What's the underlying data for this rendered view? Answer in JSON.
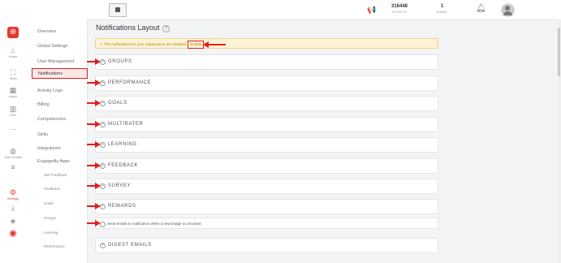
{
  "rail": {
    "items": [
      {
        "icon": "⌂",
        "label": "Home"
      },
      {
        "icon": "⛶",
        "label": "Team"
      },
      {
        "icon": "▦",
        "label": "Agent"
      },
      {
        "icon": "▥",
        "label": "ChO"
      },
      {
        "icon": "···",
        "label": ""
      },
      {
        "icon": "◍",
        "label": "Team Profile"
      },
      {
        "icon": "≡",
        "label": ""
      },
      {
        "icon": "⚙",
        "label": "Settings"
      },
      {
        "icon": "⤓",
        "label": ""
      },
      {
        "icon": "◈",
        "label": ""
      }
    ]
  },
  "nav": {
    "items": [
      "Overview",
      "Global Settings",
      "User Management",
      "Notifications",
      "Activity Logs",
      "Billing",
      "Competencies",
      "Skills",
      "Integrations",
      "Engagedly Apps"
    ],
    "sub_items": [
      "360 Feedback",
      "Feedback",
      "Goals",
      "Groups",
      "Learning",
      "Performance"
    ]
  },
  "header": {
    "points_value": "316448",
    "points_label": "POINTS",
    "rank_value": "1",
    "rank_label": "RANK"
  },
  "page": {
    "title": "Notifications Layout",
    "warning_text": "⚠ The notifications for your organisation are disabled",
    "enable_label": "Enable"
  },
  "sections": [
    "GROUPS",
    "PERFORMANCE",
    "GOALS",
    "MULTIRATER",
    "LEARNING",
    "FEEDBACK",
    "SURVEY",
    "REWARDS"
  ],
  "rewards_option": "Send emails to notification when a new badge is unlocked",
  "digest_label": "DIGEST EMAILS",
  "colors": {
    "accent": "#e8362b",
    "annotation": "#e41e1e",
    "warning_bg": "#fcf3d8"
  }
}
